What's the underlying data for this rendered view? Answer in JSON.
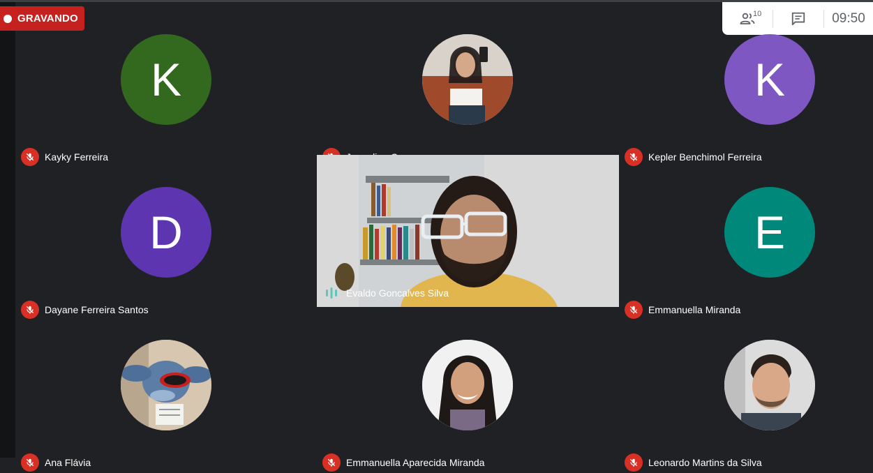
{
  "recording": {
    "label": "GRAVANDO"
  },
  "topbar": {
    "participant_count": "10",
    "people_icon": "people-icon",
    "chat_icon": "chat-icon",
    "time": "09:50"
  },
  "colors": {
    "recording_red": "#c5221f",
    "mic_off_red": "#d93025",
    "background": "#202124",
    "speaking_teal": "#5ec7b9"
  },
  "participants": [
    {
      "name": "Kayky Ferreira",
      "avatar_letter": "K",
      "avatar_color": "#33691e",
      "muted": true
    },
    {
      "name": "Jaqueline Camargos",
      "avatar_photo": true,
      "muted": true
    },
    {
      "name": "Kepler Benchimol Ferreira",
      "avatar_letter": "K",
      "avatar_color": "#7e57c2",
      "muted": true
    },
    {
      "name": "Dayane Ferreira Santos",
      "avatar_letter": "D",
      "avatar_color": "#5e35b1",
      "muted": true
    },
    {
      "name": "Evaldo Goncalves Silva",
      "video_on": true,
      "speaking": true
    },
    {
      "name": "Emmanuella Miranda",
      "avatar_letter": "E",
      "avatar_color": "#00897b",
      "muted": true
    },
    {
      "name": "Ana Flávia",
      "avatar_photo": true,
      "muted": true
    },
    {
      "name": "Emmanuella Aparecida Miranda",
      "avatar_photo": true,
      "muted": true
    },
    {
      "name": "Leonardo Martins da Silva",
      "avatar_photo": true,
      "muted": true
    }
  ]
}
